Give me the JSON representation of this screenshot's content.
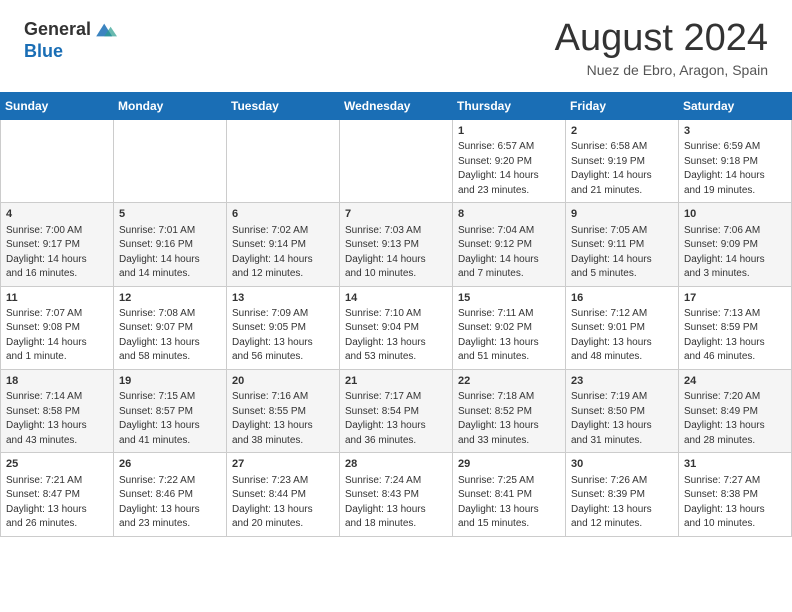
{
  "header": {
    "logo_line1": "General",
    "logo_line2": "Blue",
    "month_year": "August 2024",
    "location": "Nuez de Ebro, Aragon, Spain"
  },
  "weekdays": [
    "Sunday",
    "Monday",
    "Tuesday",
    "Wednesday",
    "Thursday",
    "Friday",
    "Saturday"
  ],
  "weeks": [
    [
      {
        "day": "",
        "info": ""
      },
      {
        "day": "",
        "info": ""
      },
      {
        "day": "",
        "info": ""
      },
      {
        "day": "",
        "info": ""
      },
      {
        "day": "1",
        "info": "Sunrise: 6:57 AM\nSunset: 9:20 PM\nDaylight: 14 hours\nand 23 minutes."
      },
      {
        "day": "2",
        "info": "Sunrise: 6:58 AM\nSunset: 9:19 PM\nDaylight: 14 hours\nand 21 minutes."
      },
      {
        "day": "3",
        "info": "Sunrise: 6:59 AM\nSunset: 9:18 PM\nDaylight: 14 hours\nand 19 minutes."
      }
    ],
    [
      {
        "day": "4",
        "info": "Sunrise: 7:00 AM\nSunset: 9:17 PM\nDaylight: 14 hours\nand 16 minutes."
      },
      {
        "day": "5",
        "info": "Sunrise: 7:01 AM\nSunset: 9:16 PM\nDaylight: 14 hours\nand 14 minutes."
      },
      {
        "day": "6",
        "info": "Sunrise: 7:02 AM\nSunset: 9:14 PM\nDaylight: 14 hours\nand 12 minutes."
      },
      {
        "day": "7",
        "info": "Sunrise: 7:03 AM\nSunset: 9:13 PM\nDaylight: 14 hours\nand 10 minutes."
      },
      {
        "day": "8",
        "info": "Sunrise: 7:04 AM\nSunset: 9:12 PM\nDaylight: 14 hours\nand 7 minutes."
      },
      {
        "day": "9",
        "info": "Sunrise: 7:05 AM\nSunset: 9:11 PM\nDaylight: 14 hours\nand 5 minutes."
      },
      {
        "day": "10",
        "info": "Sunrise: 7:06 AM\nSunset: 9:09 PM\nDaylight: 14 hours\nand 3 minutes."
      }
    ],
    [
      {
        "day": "11",
        "info": "Sunrise: 7:07 AM\nSunset: 9:08 PM\nDaylight: 14 hours\nand 1 minute."
      },
      {
        "day": "12",
        "info": "Sunrise: 7:08 AM\nSunset: 9:07 PM\nDaylight: 13 hours\nand 58 minutes."
      },
      {
        "day": "13",
        "info": "Sunrise: 7:09 AM\nSunset: 9:05 PM\nDaylight: 13 hours\nand 56 minutes."
      },
      {
        "day": "14",
        "info": "Sunrise: 7:10 AM\nSunset: 9:04 PM\nDaylight: 13 hours\nand 53 minutes."
      },
      {
        "day": "15",
        "info": "Sunrise: 7:11 AM\nSunset: 9:02 PM\nDaylight: 13 hours\nand 51 minutes."
      },
      {
        "day": "16",
        "info": "Sunrise: 7:12 AM\nSunset: 9:01 PM\nDaylight: 13 hours\nand 48 minutes."
      },
      {
        "day": "17",
        "info": "Sunrise: 7:13 AM\nSunset: 8:59 PM\nDaylight: 13 hours\nand 46 minutes."
      }
    ],
    [
      {
        "day": "18",
        "info": "Sunrise: 7:14 AM\nSunset: 8:58 PM\nDaylight: 13 hours\nand 43 minutes."
      },
      {
        "day": "19",
        "info": "Sunrise: 7:15 AM\nSunset: 8:57 PM\nDaylight: 13 hours\nand 41 minutes."
      },
      {
        "day": "20",
        "info": "Sunrise: 7:16 AM\nSunset: 8:55 PM\nDaylight: 13 hours\nand 38 minutes."
      },
      {
        "day": "21",
        "info": "Sunrise: 7:17 AM\nSunset: 8:54 PM\nDaylight: 13 hours\nand 36 minutes."
      },
      {
        "day": "22",
        "info": "Sunrise: 7:18 AM\nSunset: 8:52 PM\nDaylight: 13 hours\nand 33 minutes."
      },
      {
        "day": "23",
        "info": "Sunrise: 7:19 AM\nSunset: 8:50 PM\nDaylight: 13 hours\nand 31 minutes."
      },
      {
        "day": "24",
        "info": "Sunrise: 7:20 AM\nSunset: 8:49 PM\nDaylight: 13 hours\nand 28 minutes."
      }
    ],
    [
      {
        "day": "25",
        "info": "Sunrise: 7:21 AM\nSunset: 8:47 PM\nDaylight: 13 hours\nand 26 minutes."
      },
      {
        "day": "26",
        "info": "Sunrise: 7:22 AM\nSunset: 8:46 PM\nDaylight: 13 hours\nand 23 minutes."
      },
      {
        "day": "27",
        "info": "Sunrise: 7:23 AM\nSunset: 8:44 PM\nDaylight: 13 hours\nand 20 minutes."
      },
      {
        "day": "28",
        "info": "Sunrise: 7:24 AM\nSunset: 8:43 PM\nDaylight: 13 hours\nand 18 minutes."
      },
      {
        "day": "29",
        "info": "Sunrise: 7:25 AM\nSunset: 8:41 PM\nDaylight: 13 hours\nand 15 minutes."
      },
      {
        "day": "30",
        "info": "Sunrise: 7:26 AM\nSunset: 8:39 PM\nDaylight: 13 hours\nand 12 minutes."
      },
      {
        "day": "31",
        "info": "Sunrise: 7:27 AM\nSunset: 8:38 PM\nDaylight: 13 hours\nand 10 minutes."
      }
    ]
  ]
}
